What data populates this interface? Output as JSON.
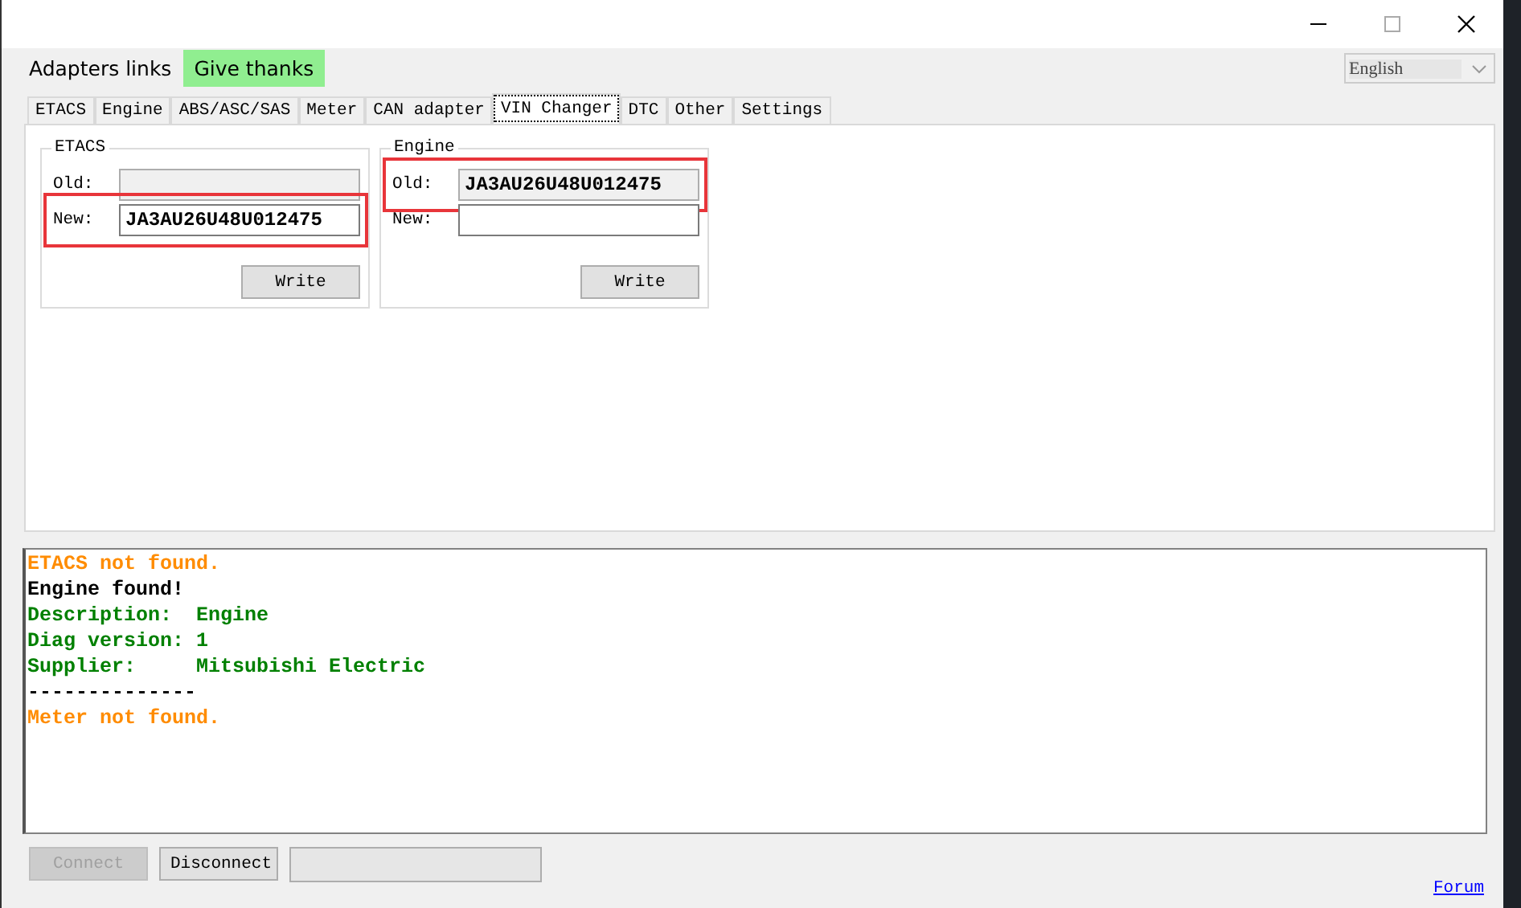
{
  "menu": [
    {
      "label": "Adapters links",
      "highlighted": false
    },
    {
      "label": "Give thanks",
      "highlighted": true
    }
  ],
  "language": {
    "value": "English"
  },
  "tabs": [
    {
      "label": "ETACS",
      "selected": false
    },
    {
      "label": "Engine",
      "selected": false
    },
    {
      "label": "ABS/ASC/SAS",
      "selected": false
    },
    {
      "label": "Meter",
      "selected": false
    },
    {
      "label": "CAN adapter",
      "selected": false
    },
    {
      "label": "VIN Changer",
      "selected": true
    },
    {
      "label": "DTC",
      "selected": false
    },
    {
      "label": "Other",
      "selected": false
    },
    {
      "label": "Settings",
      "selected": false
    }
  ],
  "groups": [
    {
      "title": "ETACS",
      "rows": [
        {
          "label": "Old:",
          "value": "",
          "disabled": true,
          "highlighted": false
        },
        {
          "label": "New:",
          "value": "JA3AU26U48U012475",
          "disabled": false,
          "highlighted": true
        }
      ],
      "button": "Write"
    },
    {
      "title": "Engine",
      "rows": [
        {
          "label": "Old:",
          "value": "JA3AU26U48U012475",
          "disabled": true,
          "highlighted": true
        },
        {
          "label": "New:",
          "value": "",
          "disabled": false,
          "highlighted": false
        }
      ],
      "button": "Write"
    }
  ],
  "log": [
    {
      "text": "ETACS not found.",
      "kind": "error"
    },
    {
      "text": "Engine found!",
      "kind": "plain"
    },
    {
      "text": "Description:  Engine",
      "kind": "info"
    },
    {
      "text": "Diag version: 1",
      "kind": "info"
    },
    {
      "text": "Supplier:     Mitsubishi Electric",
      "kind": "info"
    },
    {
      "text": "--------------",
      "kind": "plain"
    },
    {
      "text": "Meter not found.",
      "kind": "error"
    }
  ],
  "bottom": {
    "buttons": [
      {
        "label": "Connect",
        "disabled": true
      },
      {
        "label": "Disconnect",
        "disabled": false
      }
    ],
    "link": "Forum"
  }
}
